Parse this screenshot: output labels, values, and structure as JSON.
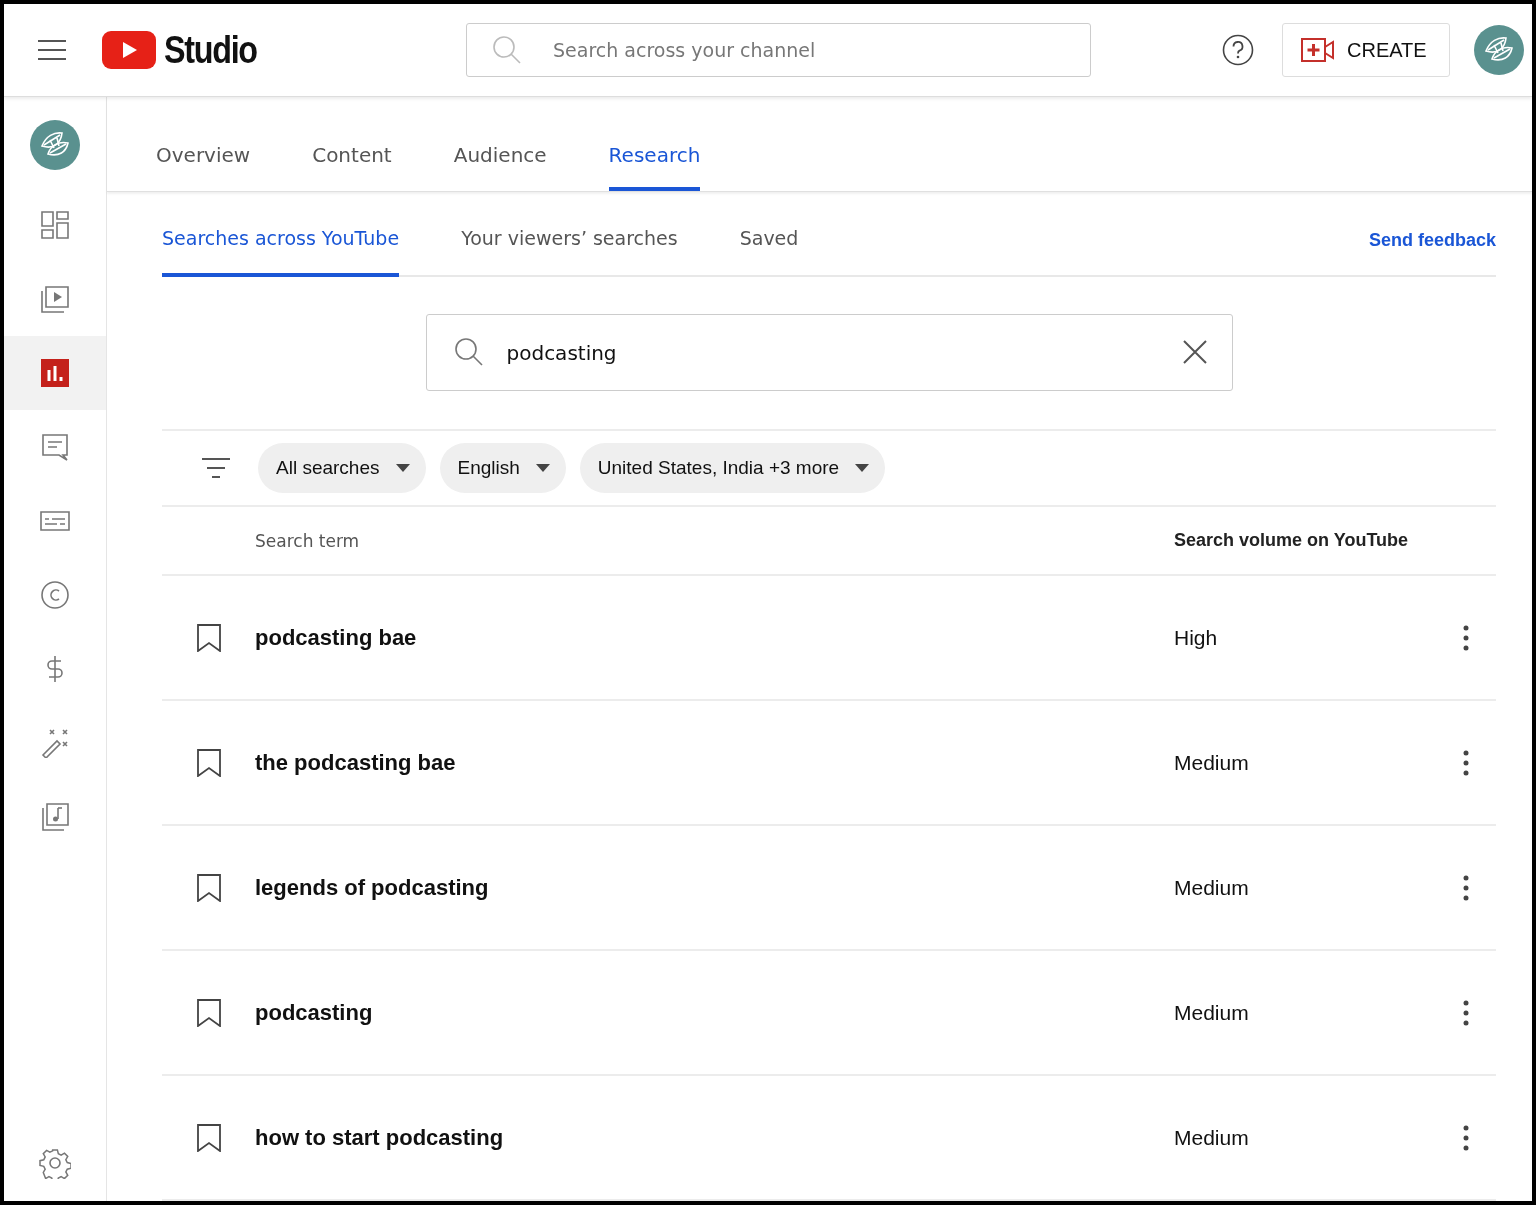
{
  "header": {
    "logo_text": "Studio",
    "search": {
      "placeholder": "Search across your channel"
    },
    "create_button": "CREATE"
  },
  "sidebar": {
    "items": [
      {
        "selected": false
      },
      {
        "selected": false
      },
      {
        "selected": true
      },
      {
        "selected": false
      },
      {
        "selected": false
      },
      {
        "selected": false
      },
      {
        "selected": false
      },
      {
        "selected": false
      },
      {
        "selected": false
      }
    ]
  },
  "tabs": [
    {
      "label": "Overview",
      "selected": false
    },
    {
      "label": "Content",
      "selected": false
    },
    {
      "label": "Audience",
      "selected": false
    },
    {
      "label": "Research",
      "selected": true
    }
  ],
  "subtabs": [
    {
      "label": "Searches across YouTube",
      "selected": true
    },
    {
      "label": "Your viewers’ searches",
      "selected": false
    },
    {
      "label": "Saved",
      "selected": false
    }
  ],
  "send_feedback": "Send feedback",
  "query": {
    "value": "podcasting"
  },
  "filters": [
    {
      "label": "All searches"
    },
    {
      "label": "English"
    },
    {
      "label": "United States, India +3 more"
    }
  ],
  "table": {
    "columns": [
      "Search term",
      "Search volume on YouTube"
    ],
    "rows": [
      {
        "term": "podcasting bae",
        "volume": "High"
      },
      {
        "term": "the podcasting bae",
        "volume": "Medium"
      },
      {
        "term": "legends of podcasting",
        "volume": "Medium"
      },
      {
        "term": "podcasting",
        "volume": "Medium"
      },
      {
        "term": "how to start podcasting",
        "volume": "Medium"
      }
    ]
  }
}
